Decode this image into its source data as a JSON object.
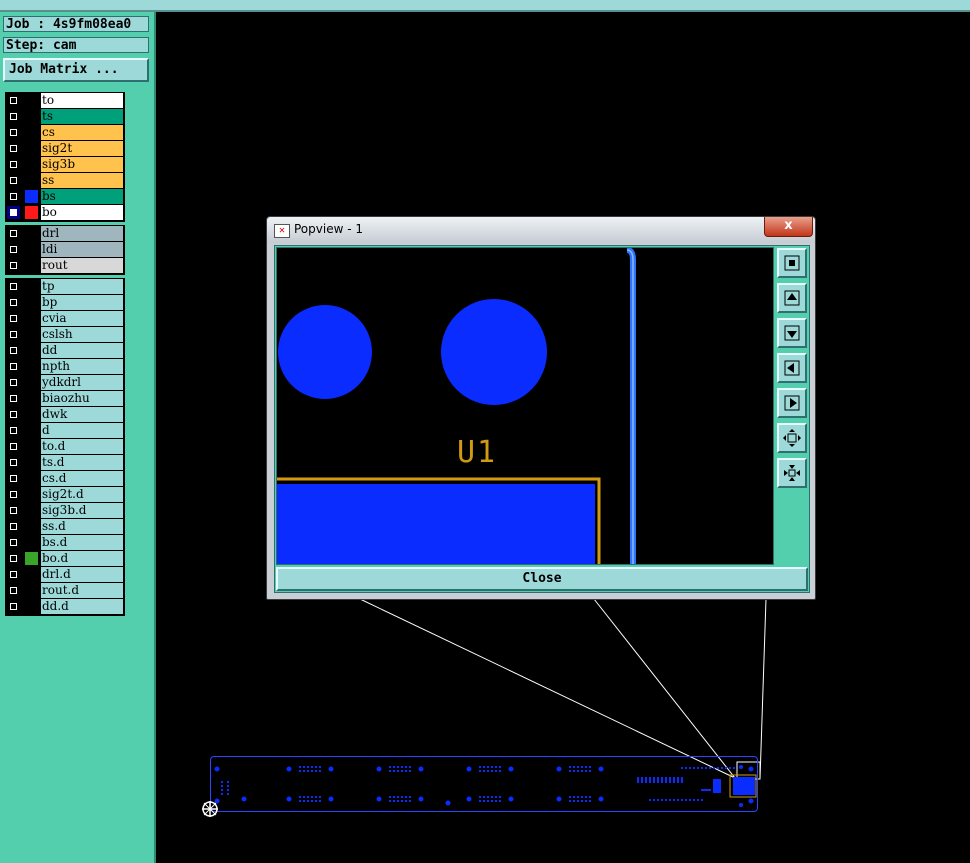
{
  "job": {
    "job_label": "Job : 4s9fm08ea0",
    "step_label": "Step: cam",
    "matrix_button": "Job Matrix ..."
  },
  "layers": {
    "board": [
      {
        "name": "to",
        "bg": "#ffffff",
        "swatch": "#000000",
        "checked": false
      },
      {
        "name": "ts",
        "bg": "#00a07a",
        "swatch": "#000000",
        "checked": false
      },
      {
        "name": "cs",
        "bg": "#ffc24d",
        "swatch": "#000000",
        "checked": false
      },
      {
        "name": "sig2t",
        "bg": "#ffc24d",
        "swatch": "#000000",
        "checked": false
      },
      {
        "name": "sig3b",
        "bg": "#ffc24d",
        "swatch": "#000000",
        "checked": false
      },
      {
        "name": "ss",
        "bg": "#ffc24d",
        "swatch": "#000000",
        "checked": false
      },
      {
        "name": "bs",
        "bg": "#00a07a",
        "swatch": "#0a2cff",
        "checked": false
      },
      {
        "name": "bo",
        "bg": "#ffffff",
        "swatch": "#ff1a1a",
        "checked": true
      }
    ],
    "drill": [
      {
        "name": "drl",
        "bg": "#9fb6bf",
        "swatch": "#000000",
        "checked": false
      },
      {
        "name": "ldi",
        "bg": "#9fb6bf",
        "swatch": "#000000",
        "checked": false
      },
      {
        "name": "rout",
        "bg": "#d8d8d8",
        "swatch": "#000000",
        "checked": false
      }
    ],
    "misc": [
      {
        "name": "tp",
        "bg": "#9ed9d9",
        "swatch": "#000000",
        "checked": false
      },
      {
        "name": "bp",
        "bg": "#9ed9d9",
        "swatch": "#000000",
        "checked": false
      },
      {
        "name": "cvia",
        "bg": "#9ed9d9",
        "swatch": "#000000",
        "checked": false
      },
      {
        "name": "cslsh",
        "bg": "#9ed9d9",
        "swatch": "#000000",
        "checked": false
      },
      {
        "name": "dd",
        "bg": "#9ed9d9",
        "swatch": "#000000",
        "checked": false
      },
      {
        "name": "npth",
        "bg": "#9ed9d9",
        "swatch": "#000000",
        "checked": false
      },
      {
        "name": "ydkdrl",
        "bg": "#9ed9d9",
        "swatch": "#000000",
        "checked": false
      },
      {
        "name": "biaozhu",
        "bg": "#9ed9d9",
        "swatch": "#000000",
        "checked": false
      },
      {
        "name": "dwk",
        "bg": "#9ed9d9",
        "swatch": "#000000",
        "checked": false
      },
      {
        "name": "d",
        "bg": "#9ed9d9",
        "swatch": "#000000",
        "checked": false
      },
      {
        "name": "to.d",
        "bg": "#9ed9d9",
        "swatch": "#000000",
        "checked": false
      },
      {
        "name": "ts.d",
        "bg": "#9ed9d9",
        "swatch": "#000000",
        "checked": false
      },
      {
        "name": "cs.d",
        "bg": "#9ed9d9",
        "swatch": "#000000",
        "checked": false
      },
      {
        "name": "sig2t.d",
        "bg": "#9ed9d9",
        "swatch": "#000000",
        "checked": false
      },
      {
        "name": "sig3b.d",
        "bg": "#9ed9d9",
        "swatch": "#000000",
        "checked": false
      },
      {
        "name": "ss.d",
        "bg": "#9ed9d9",
        "swatch": "#000000",
        "checked": false
      },
      {
        "name": "bs.d",
        "bg": "#9ed9d9",
        "swatch": "#000000",
        "checked": false
      },
      {
        "name": "bo.d",
        "bg": "#9ed9d9",
        "swatch": "#3aa32a",
        "checked": false
      },
      {
        "name": "drl.d",
        "bg": "#9ed9d9",
        "swatch": "#000000",
        "checked": false
      },
      {
        "name": "rout.d",
        "bg": "#9ed9d9",
        "swatch": "#000000",
        "checked": false
      },
      {
        "name": "dd.d",
        "bg": "#9ed9d9",
        "swatch": "#000000",
        "checked": false
      }
    ]
  },
  "popview": {
    "title": "Popview - 1",
    "close_x": "x",
    "component_label": "U1",
    "close_button": "Close",
    "tools": [
      "zoom-extents-icon",
      "pan-up-icon",
      "pan-down-icon",
      "pan-left-icon",
      "pan-right-icon",
      "zoom-in-icon",
      "zoom-out-icon"
    ]
  },
  "colors": {
    "panel": "#54cfad",
    "button": "#9ed9d9",
    "copper": "#0a2cff",
    "silkscreen": "#d29a12",
    "canvas": "#000000"
  }
}
